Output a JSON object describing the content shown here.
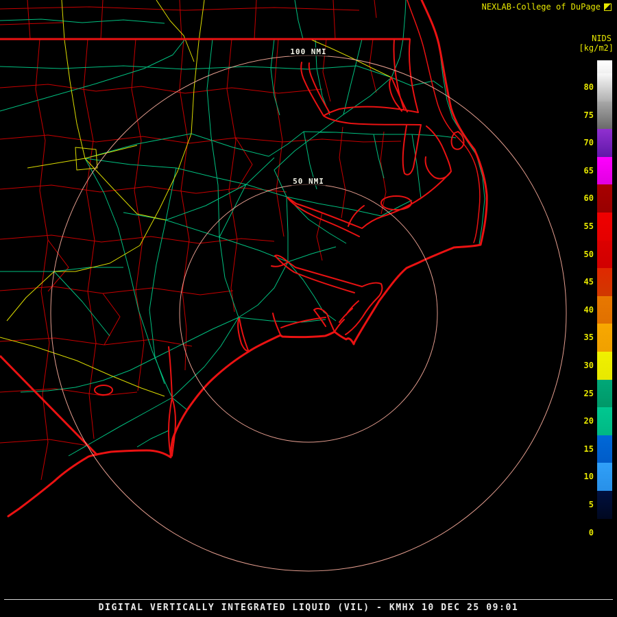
{
  "header": {
    "brand": "NEXLAB-College of DuPage",
    "product_code": "NIDS",
    "units": "[kg/m2]"
  },
  "rings": {
    "outer_label": "100 NMI",
    "inner_label": "50 NMI"
  },
  "colorbar": {
    "labels": [
      "80",
      "75",
      "70",
      "65",
      "60",
      "55",
      "50",
      "45",
      "40",
      "35",
      "30",
      "25",
      "20",
      "15",
      "10",
      "5",
      "0"
    ],
    "segments": [
      {
        "value": "cap",
        "colors": [
          "#ffffff",
          "#f0f0f0"
        ]
      },
      {
        "value": "80",
        "colors": [
          "#f8f8f8",
          "#b0b0b0"
        ]
      },
      {
        "value": "75",
        "colors": [
          "#a8a8a8",
          "#6a6a6a"
        ]
      },
      {
        "value": "70",
        "colors": [
          "#9030d0",
          "#6018a8"
        ]
      },
      {
        "value": "65",
        "colors": [
          "#ff00ff",
          "#e000e0"
        ]
      },
      {
        "value": "60",
        "colors": [
          "#a80000",
          "#980000"
        ]
      },
      {
        "value": "55",
        "colors": [
          "#f00000",
          "#e40000"
        ]
      },
      {
        "value": "50",
        "colors": [
          "#dc0000",
          "#d00000"
        ]
      },
      {
        "value": "45",
        "colors": [
          "#e02800",
          "#d03800"
        ]
      },
      {
        "value": "40",
        "colors": [
          "#e87800",
          "#e07000"
        ]
      },
      {
        "value": "35",
        "colors": [
          "#f8a800",
          "#f0a000"
        ]
      },
      {
        "value": "30",
        "colors": [
          "#f0f000",
          "#e8e800"
        ]
      },
      {
        "value": "25",
        "colors": [
          "#00a878",
          "#009868"
        ]
      },
      {
        "value": "20",
        "colors": [
          "#00c890",
          "#00b884"
        ]
      },
      {
        "value": "15",
        "colors": [
          "#0068d8",
          "#005cc8"
        ]
      },
      {
        "value": "10",
        "colors": [
          "#30a0f8",
          "#2890e8"
        ]
      },
      {
        "value": "5",
        "colors": [
          "#001040",
          "#000820"
        ]
      },
      {
        "value": "0",
        "colors": [
          "#000000",
          "#000000"
        ]
      }
    ]
  },
  "footer": {
    "title": "DIGITAL VERTICALLY INTEGRATED LIQUID (VIL) - KMHX 10 DEC 25 09:01"
  },
  "colors": {
    "background": "#000000",
    "county_lines": "#d40000",
    "coastline": "#ea1212",
    "roads_green": "#00c080",
    "roads_yellow": "#dcdc00",
    "range_rings": "#ffb0a0",
    "annotation_yellow": "#e8e800",
    "footer_text": "#ececec"
  }
}
